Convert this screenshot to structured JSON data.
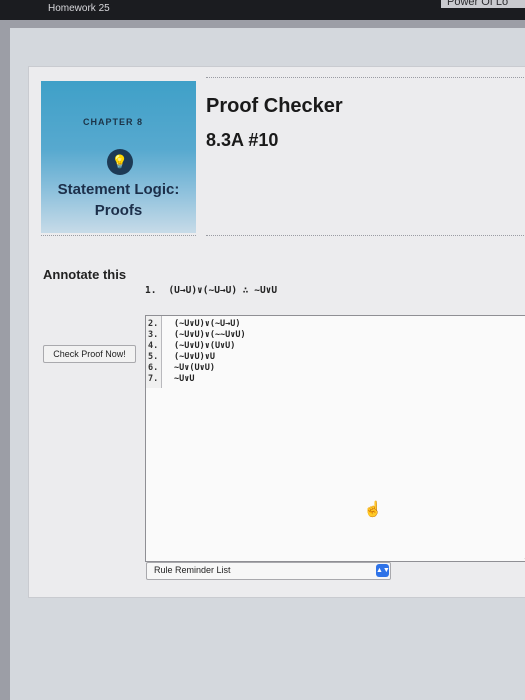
{
  "topbar": {
    "title": "Homework 25",
    "right_text": "Power Of Lo"
  },
  "chapter": {
    "label": "CHAPTER 8",
    "icon": "lightbulb-icon",
    "icon_glyph": "💡",
    "title_line1": "Statement Logic:",
    "title_line2": "Proofs"
  },
  "header": {
    "title": "Proof Checker",
    "subtitle": "8.3A #10"
  },
  "annotate": {
    "label": "Annotate this"
  },
  "premise": {
    "number": "1.",
    "formula": "(U→U)∨(~U→U)  ∴  ~U∨U"
  },
  "check_button": {
    "label": "Check Proof Now!"
  },
  "proof_lines": [
    {
      "num": "2.",
      "text": "(~U∨U)∨(~U→U)"
    },
    {
      "num": "3.",
      "text": "(~U∨U)∨(~~U∨U)"
    },
    {
      "num": "4.",
      "text": "(~U∨U)∨(U∨U)"
    },
    {
      "num": "5.",
      "text": "(~U∨U)∨U"
    },
    {
      "num": "6.",
      "text": "~U∨(U∨U)"
    },
    {
      "num": "7.",
      "text": "~U∨U"
    }
  ],
  "cursor_icon": "pointer-hand-icon",
  "cursor_glyph": "☝",
  "resize_glyph": "◢",
  "rule_reminder": {
    "label": "Rule Reminder List",
    "arrow_glyph": "▲▼"
  },
  "colors": {
    "accent_blue": "#2f73e8",
    "chapter_blue": "#3fa0c8"
  }
}
